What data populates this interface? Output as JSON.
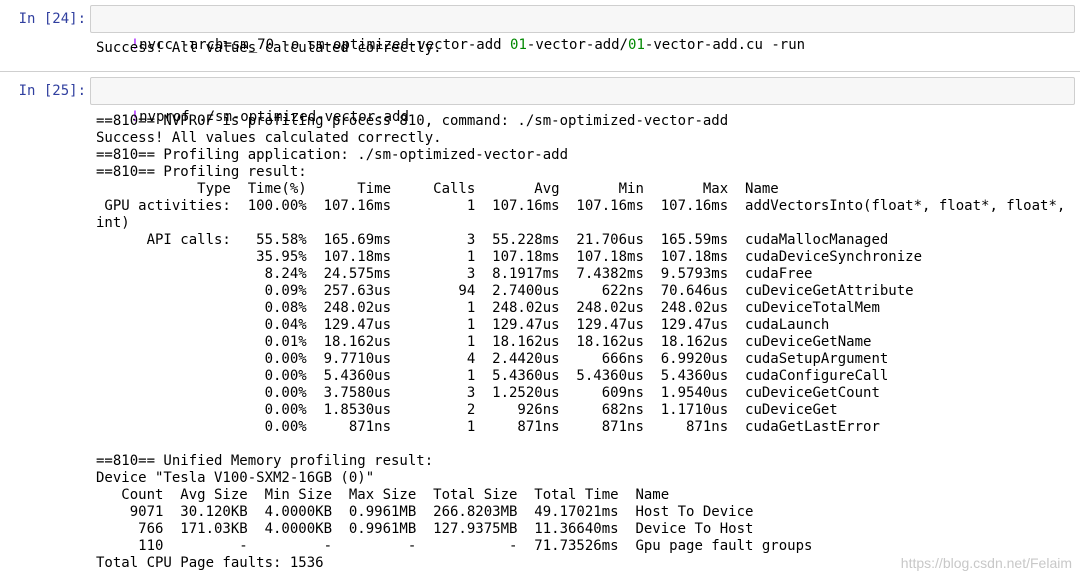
{
  "cells": [
    {
      "prompt": "In [24]:",
      "input_parts": [
        {
          "cls": "tok-bang",
          "text": "!"
        },
        {
          "cls": "tok-cmd",
          "text": "nvcc -arch=sm_70 -o sm-optimized-vector-add "
        },
        {
          "cls": "tok-num",
          "text": "01"
        },
        {
          "cls": "tok-cmd",
          "text": "-vector-add/"
        },
        {
          "cls": "tok-num",
          "text": "01"
        },
        {
          "cls": "tok-cmd",
          "text": "-vector-add.cu -run"
        }
      ],
      "output": "Success! All values calculated correctly."
    },
    {
      "prompt": "In [25]:",
      "input_parts": [
        {
          "cls": "tok-bang",
          "text": "!"
        },
        {
          "cls": "tok-cmd",
          "text": "nvprof ./sm-optimized-vector-add"
        }
      ],
      "output": "==810== NVPROF is profiling process 810, command: ./sm-optimized-vector-add\nSuccess! All values calculated correctly.\n==810== Profiling application: ./sm-optimized-vector-add\n==810== Profiling result:\n            Type  Time(%)      Time     Calls       Avg       Min       Max  Name\n GPU activities:  100.00%  107.16ms         1  107.16ms  107.16ms  107.16ms  addVectorsInto(float*, float*, float*,\nint)\n      API calls:   55.58%  165.69ms         3  55.228ms  21.706us  165.59ms  cudaMallocManaged\n                   35.95%  107.18ms         1  107.18ms  107.18ms  107.18ms  cudaDeviceSynchronize\n                    8.24%  24.575ms         3  8.1917ms  7.4382ms  9.5793ms  cudaFree\n                    0.09%  257.63us        94  2.7400us     622ns  70.646us  cuDeviceGetAttribute\n                    0.08%  248.02us         1  248.02us  248.02us  248.02us  cuDeviceTotalMem\n                    0.04%  129.47us         1  129.47us  129.47us  129.47us  cudaLaunch\n                    0.01%  18.162us         1  18.162us  18.162us  18.162us  cuDeviceGetName\n                    0.00%  9.7710us         4  2.4420us     666ns  6.9920us  cudaSetupArgument\n                    0.00%  5.4360us         1  5.4360us  5.4360us  5.4360us  cudaConfigureCall\n                    0.00%  3.7580us         3  1.2520us     609ns  1.9540us  cuDeviceGetCount\n                    0.00%  1.8530us         2     926ns     682ns  1.1710us  cuDeviceGet\n                    0.00%     871ns         1     871ns     871ns     871ns  cudaGetLastError\n\n==810== Unified Memory profiling result:\nDevice \"Tesla V100-SXM2-16GB (0)\"\n   Count  Avg Size  Min Size  Max Size  Total Size  Total Time  Name\n    9071  30.120KB  4.0000KB  0.9961MB  266.8203MB  49.17021ms  Host To Device\n     766  171.03KB  4.0000KB  0.9961MB  127.9375MB  11.36640ms  Device To Host\n     110         -         -         -           -  71.73526ms  Gpu page fault groups\nTotal CPU Page faults: 1536"
    }
  ],
  "watermark": "https://blog.csdn.net/Felaim",
  "colors": {
    "prompt": "#303F9F",
    "bang": "#AA22FF",
    "number": "#008800",
    "input_bg": "#f7f7f7",
    "border": "#cfcfcf"
  }
}
